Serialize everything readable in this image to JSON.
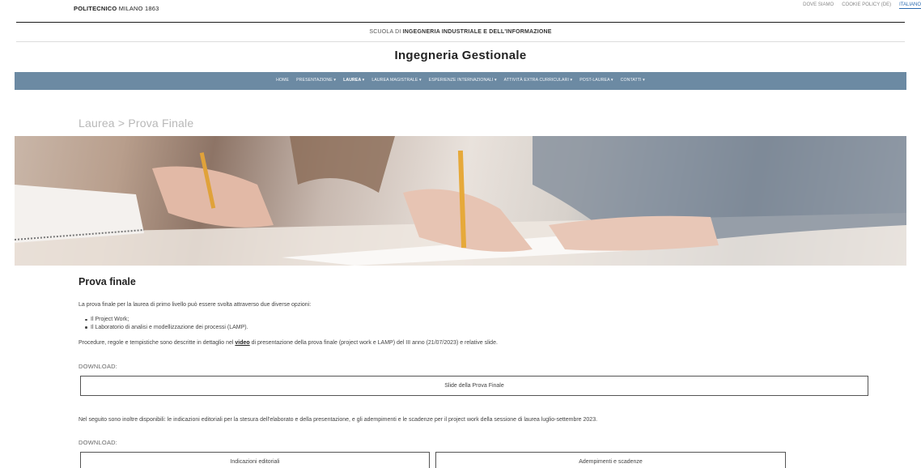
{
  "topbar": {
    "brand_bold": "POLITECNICO",
    "brand_rest": " MILANO 1863",
    "links": [
      "DOVE SIAMO",
      "COOKIE POLICY (DE)",
      "ITALIANO"
    ]
  },
  "header": {
    "school_prefix": "SCUOLA DI ",
    "school_name": "INGEGNERIA INDUSTRIALE E DELL'INFORMAZIONE",
    "site_title": "Ingegneria Gestionale"
  },
  "nav": {
    "items": [
      {
        "label": "HOME"
      },
      {
        "label": "PRESENTAZIONE ▾"
      },
      {
        "label": "LAUREA ▾"
      },
      {
        "label": "LAUREA MAGISTRALE ▾"
      },
      {
        "label": "ESPERIENZE INTERNAZIONALI ▾"
      },
      {
        "label": "ATTIVITÀ EXTRA CURRICULARI ▾"
      },
      {
        "label": "POST-LAUREA ▾"
      },
      {
        "label": "CONTATTI ▾"
      }
    ],
    "active_index": 2
  },
  "breadcrumb": "Laurea > Prova Finale",
  "main": {
    "heading": "Prova finale",
    "intro": "La prova finale per la laurea di primo livello può essere svolta attraverso due diverse opzioni:",
    "options": [
      "Il Project Work;",
      "Il Laboratorio di analisi e modellizzazione dei processi (LAMP)."
    ],
    "procedure_before": "Procedure, regole e tempistiche sono descritte in dettaglio nel ",
    "procedure_link": "video",
    "procedure_after": " di presentazione della prova finale (project work e LAMP) del III anno (21/07/2023) e relative slide.",
    "download_label_1": "DOWNLOAD:",
    "download_button_1": "Slide della Prova Finale",
    "followup": "Nel seguito sono inoltre disponibili: le indicazioni editoriali per la stesura dell'elaborato e della presentazione, e gli adempimenti e le scadenze per il project work della sessione di laurea luglio-settembre 2023.",
    "download_label_2": "DOWNLOAD:",
    "download_button_2a": "Indicazioni editoriali",
    "download_button_2b": "Adempimenti e scadenze"
  },
  "colors": {
    "nav_bg": "#6c8aa3",
    "link_active": "#2a6ab0"
  }
}
